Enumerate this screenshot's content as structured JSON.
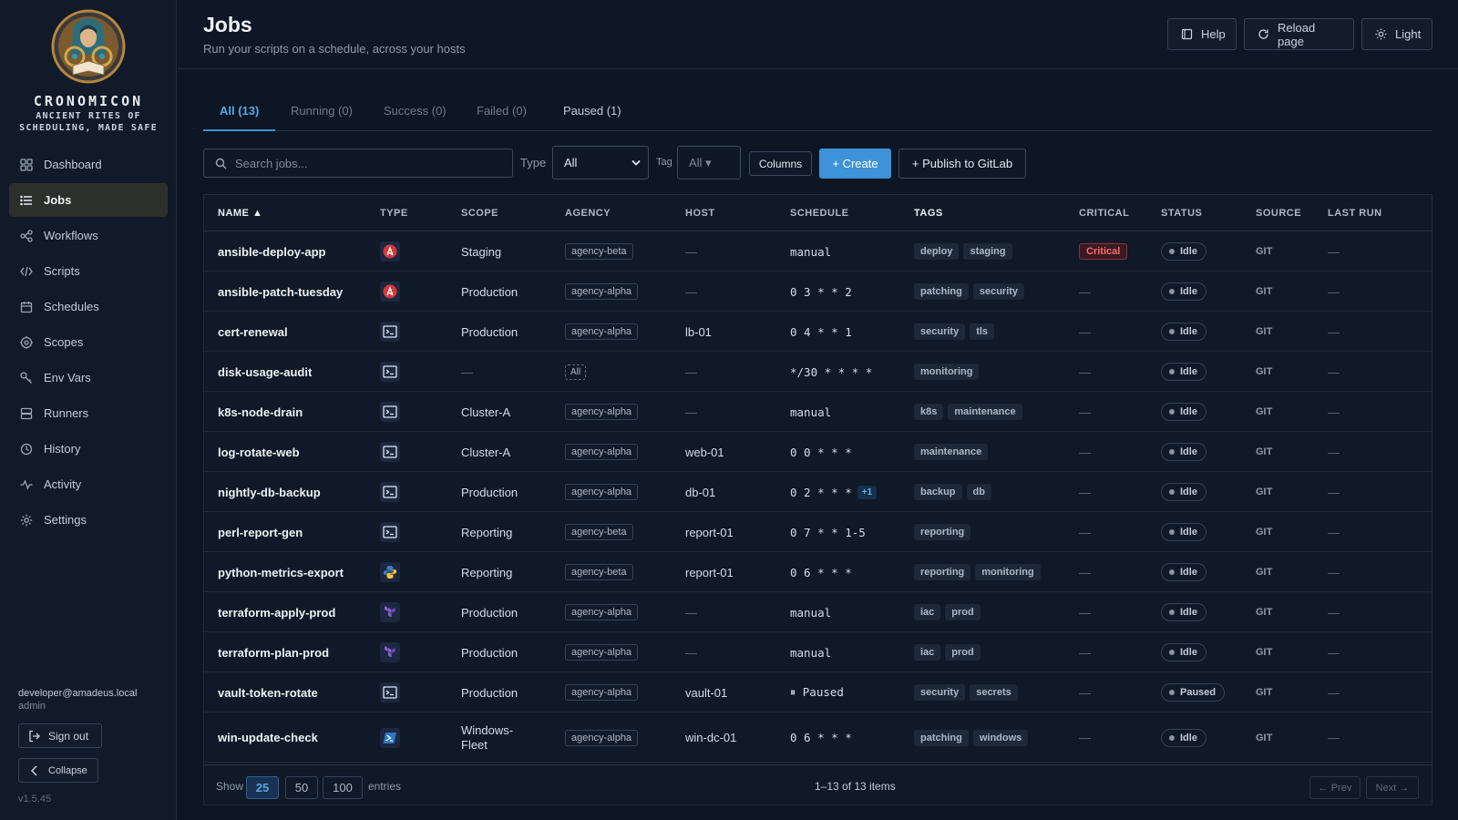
{
  "app": {
    "name": "CRONOMICON",
    "tagline": "ANCIENT RITES OF SCHEDULING, MADE SAFE",
    "version": "v1.5.45"
  },
  "sidebar": {
    "items": [
      {
        "label": "Dashboard",
        "icon": "grid-icon"
      },
      {
        "label": "Jobs",
        "icon": "list-icon",
        "active": true
      },
      {
        "label": "Workflows",
        "icon": "workflow-icon"
      },
      {
        "label": "Scripts",
        "icon": "code-icon"
      },
      {
        "label": "Schedules",
        "icon": "calendar-icon"
      },
      {
        "label": "Scopes",
        "icon": "target-icon"
      },
      {
        "label": "Env Vars",
        "icon": "key-icon"
      },
      {
        "label": "Runners",
        "icon": "server-icon"
      },
      {
        "label": "History",
        "icon": "clock-icon"
      },
      {
        "label": "Activity",
        "icon": "pulse-icon"
      },
      {
        "label": "Settings",
        "icon": "gear-icon"
      }
    ],
    "user_email": "developer@amadeus.local",
    "user_role": "admin",
    "sign_out": "Sign out",
    "collapse": "Collapse"
  },
  "header": {
    "title": "Jobs",
    "subtitle": "Run your scripts on a schedule, across your hosts",
    "help": "Help",
    "reload": "Reload page",
    "theme": "Light"
  },
  "tabs": [
    {
      "label": "All (13)",
      "active": true
    },
    {
      "label": "Running (0)"
    },
    {
      "label": "Success (0)"
    },
    {
      "label": "Failed (0)"
    },
    {
      "label": "Paused (1)"
    }
  ],
  "toolbar": {
    "search_placeholder": "Search jobs...",
    "type_label": "Type",
    "type_value": "All",
    "tag_label": "Tag",
    "tag_value": "All ▾",
    "columns": "Columns",
    "create": "+ Create",
    "publish": "+ Publish to GitLab"
  },
  "table": {
    "columns": [
      "NAME ▲",
      "TYPE",
      "SCOPE",
      "AGENCY",
      "HOST",
      "SCHEDULE",
      "TAGS",
      "CRITICAL",
      "STATUS",
      "SOURCE",
      "LAST RUN"
    ],
    "rows": [
      {
        "name": "ansible-deploy-app",
        "type": "ansible",
        "scope": "Staging",
        "agency": "agency-beta",
        "host": "—",
        "schedule": "manual",
        "tags": [
          "deploy",
          "staging"
        ],
        "critical": "Critical",
        "status": "Idle",
        "source": "GIT",
        "last_run": "—"
      },
      {
        "name": "ansible-patch-tuesday",
        "type": "ansible",
        "scope": "Production",
        "agency": "agency-alpha",
        "host": "—",
        "schedule": "0 3 * * 2",
        "tags": [
          "patching",
          "security"
        ],
        "critical": "—",
        "status": "Idle",
        "source": "GIT",
        "last_run": "—"
      },
      {
        "name": "cert-renewal",
        "type": "shell",
        "scope": "Production",
        "agency": "agency-alpha",
        "host": "lb-01",
        "schedule": "0 4 * * 1",
        "tags": [
          "security",
          "tls"
        ],
        "critical": "—",
        "status": "Idle",
        "source": "GIT",
        "last_run": "—"
      },
      {
        "name": "disk-usage-audit",
        "type": "shell",
        "scope": "—",
        "agency": "All",
        "host": "—",
        "schedule": "*/30 * * * *",
        "tags": [
          "monitoring"
        ],
        "critical": "—",
        "status": "Idle",
        "source": "GIT",
        "last_run": "—"
      },
      {
        "name": "k8s-node-drain",
        "type": "shell",
        "scope": "Cluster-A",
        "agency": "agency-alpha",
        "host": "—",
        "schedule": "manual",
        "tags": [
          "k8s",
          "maintenance"
        ],
        "critical": "—",
        "status": "Idle",
        "source": "GIT",
        "last_run": "—"
      },
      {
        "name": "log-rotate-web",
        "type": "shell",
        "scope": "Cluster-A",
        "agency": "agency-alpha",
        "host": "web-01",
        "schedule": "0 0 * * *",
        "tags": [
          "maintenance"
        ],
        "critical": "—",
        "status": "Idle",
        "source": "GIT",
        "last_run": "—"
      },
      {
        "name": "nightly-db-backup",
        "type": "shell",
        "scope": "Production",
        "agency": "agency-alpha",
        "host": "db-01",
        "schedule": "0 2 * * *",
        "schedule_more": "+1",
        "tags": [
          "backup",
          "db"
        ],
        "critical": "—",
        "status": "Idle",
        "source": "GIT",
        "last_run": "—"
      },
      {
        "name": "perl-report-gen",
        "type": "shell",
        "scope": "Reporting",
        "agency": "agency-beta",
        "host": "report-01",
        "schedule": "0 7 * * 1-5",
        "tags": [
          "reporting"
        ],
        "critical": "—",
        "status": "Idle",
        "source": "GIT",
        "last_run": "—"
      },
      {
        "name": "python-metrics-export",
        "type": "python",
        "scope": "Reporting",
        "agency": "agency-beta",
        "host": "report-01",
        "schedule": "0 6 * * *",
        "tags": [
          "reporting",
          "monitoring"
        ],
        "critical": "—",
        "status": "Idle",
        "source": "GIT",
        "last_run": "—"
      },
      {
        "name": "terraform-apply-prod",
        "type": "terraform",
        "scope": "Production",
        "agency": "agency-alpha",
        "host": "—",
        "schedule": "manual",
        "tags": [
          "iac",
          "prod"
        ],
        "critical": "—",
        "status": "Idle",
        "source": "GIT",
        "last_run": "—"
      },
      {
        "name": "terraform-plan-prod",
        "type": "terraform",
        "scope": "Production",
        "agency": "agency-alpha",
        "host": "—",
        "schedule": "manual",
        "tags": [
          "iac",
          "prod"
        ],
        "critical": "—",
        "status": "Idle",
        "source": "GIT",
        "last_run": "—"
      },
      {
        "name": "vault-token-rotate",
        "type": "shell",
        "scope": "Production",
        "agency": "agency-alpha",
        "host": "vault-01",
        "schedule": "⏸ Paused",
        "tags": [
          "security",
          "secrets"
        ],
        "critical": "—",
        "status": "Paused",
        "source": "GIT",
        "last_run": "—"
      },
      {
        "name": "win-update-check",
        "type": "powershell",
        "scope": "Windows-Fleet",
        "agency": "agency-alpha",
        "host": "win-dc-01",
        "schedule": "0 6 * * *",
        "tags": [
          "patching",
          "windows"
        ],
        "critical": "—",
        "status": "Idle",
        "source": "GIT",
        "last_run": "—"
      }
    ]
  },
  "footer": {
    "show": "Show",
    "sizes": [
      "25",
      "50",
      "100"
    ],
    "entries": "entries",
    "summary": "1–13 of 13 items",
    "prev": "← Prev",
    "next": "Next →"
  },
  "colors": {
    "accent": "#3d92d8",
    "critical": "#ff6b6b",
    "background": "#0d1623"
  }
}
